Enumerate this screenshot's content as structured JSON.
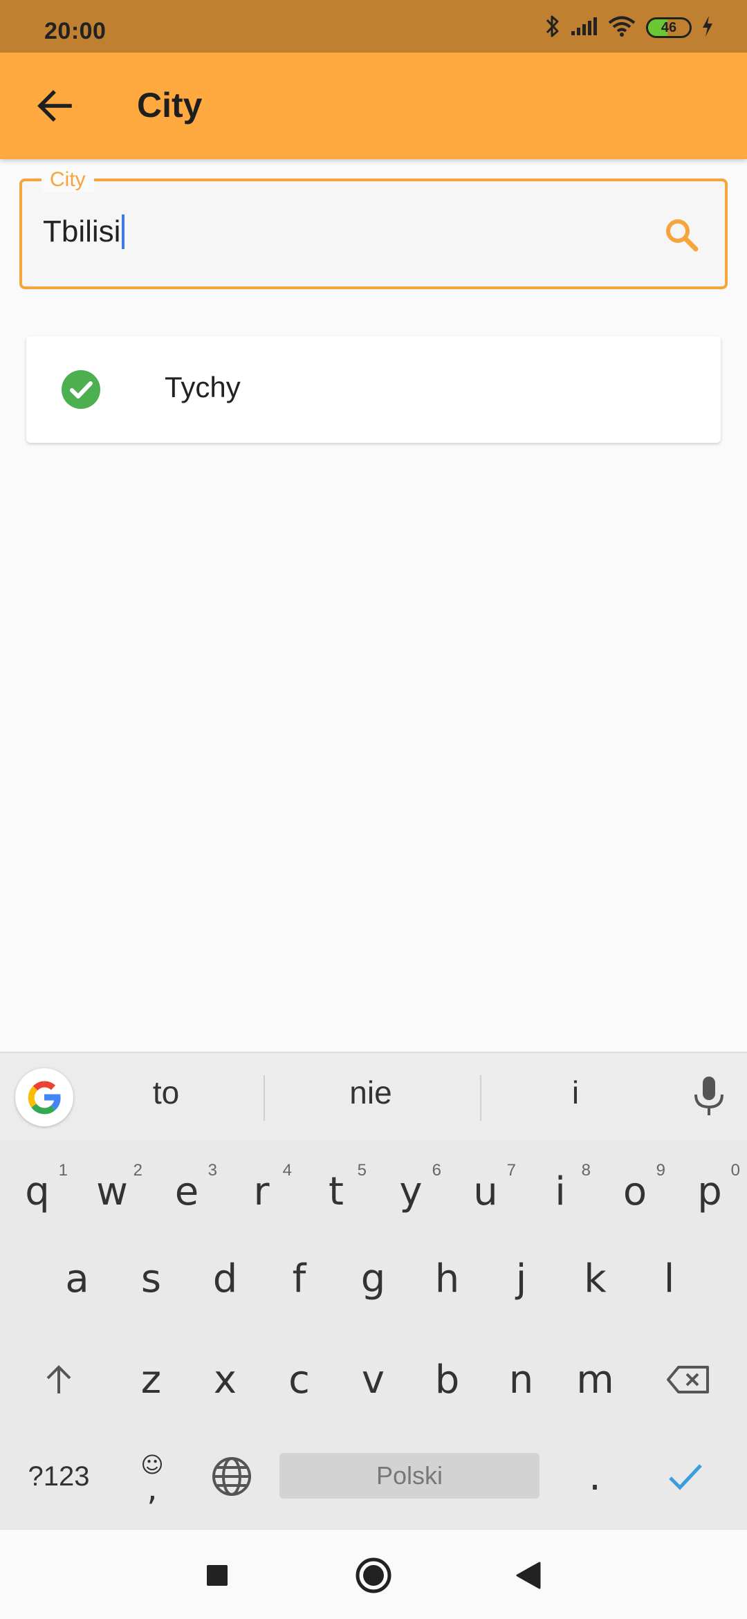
{
  "status_bar": {
    "time": "20:00",
    "battery_level": "46",
    "battery_fraction": 0.46,
    "icons": [
      "bluetooth-icon",
      "signal-icon",
      "wifi-icon",
      "battery-icon",
      "charging-icon"
    ]
  },
  "app_bar": {
    "title": "City",
    "back_icon": "arrow-back-icon"
  },
  "search": {
    "label": "City",
    "value": "Tbilisi",
    "icon": "search-icon",
    "accent_color": "#f5a53c"
  },
  "results": [
    {
      "label": "Tychy",
      "icon": "check-circle-icon",
      "icon_color": "#4caf50"
    }
  ],
  "keyboard": {
    "suggestions": [
      "to",
      "nie",
      "i"
    ],
    "row1": [
      {
        "key": "q",
        "hint": "1"
      },
      {
        "key": "w",
        "hint": "2"
      },
      {
        "key": "e",
        "hint": "3"
      },
      {
        "key": "r",
        "hint": "4"
      },
      {
        "key": "t",
        "hint": "5"
      },
      {
        "key": "y",
        "hint": "6"
      },
      {
        "key": "u",
        "hint": "7"
      },
      {
        "key": "i",
        "hint": "8"
      },
      {
        "key": "o",
        "hint": "9"
      },
      {
        "key": "p",
        "hint": "0"
      }
    ],
    "row2": [
      "a",
      "s",
      "d",
      "f",
      "g",
      "h",
      "j",
      "k",
      "l"
    ],
    "row3": [
      "z",
      "x",
      "c",
      "v",
      "b",
      "n",
      "m"
    ],
    "symbols_label": "?123",
    "comma_label": ",",
    "space_label": "Polski",
    "period_label": "."
  },
  "colors": {
    "status_bar": "#bf8032",
    "app_bar": "#ffaa40",
    "enter_key": "#3b9ddd"
  }
}
